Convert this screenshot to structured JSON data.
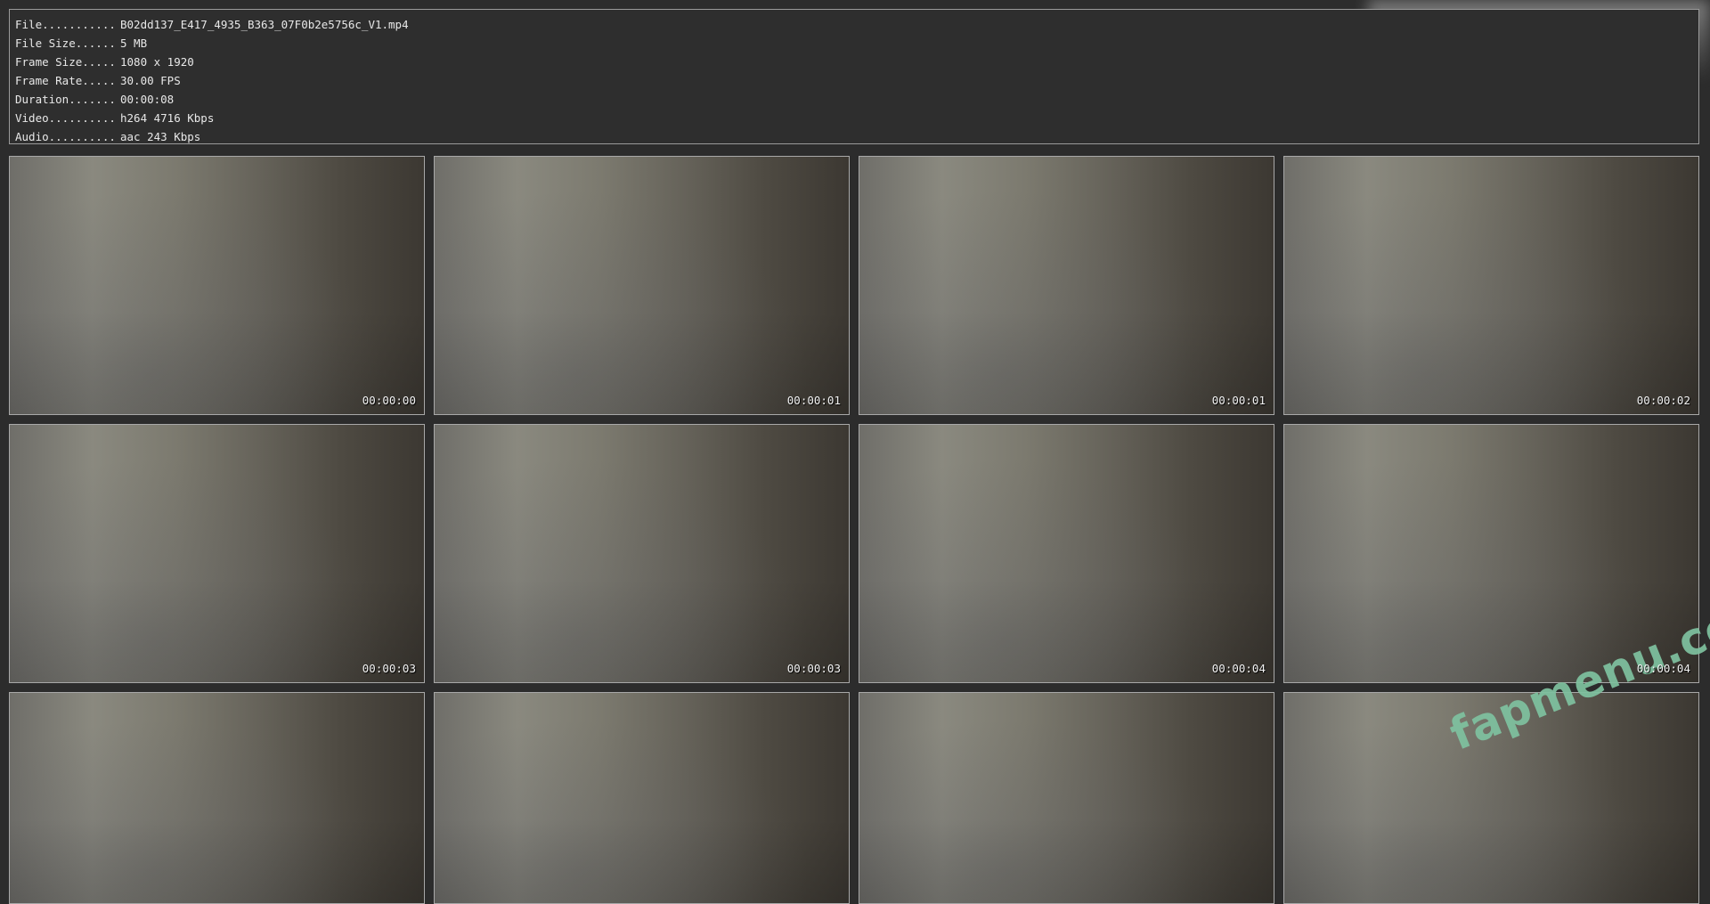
{
  "info": [
    {
      "key": "File...........",
      "value": "B02dd137_E417_4935_B363_07F0b2e5756c_V1.mp4"
    },
    {
      "key": "File Size......",
      "value": "5 MB"
    },
    {
      "key": "Frame Size.....",
      "value": "1080 x 1920"
    },
    {
      "key": "Frame Rate.....",
      "value": "30.00 FPS"
    },
    {
      "key": "Duration.......",
      "value": "00:00:08"
    },
    {
      "key": "Video..........",
      "value": "h264 4716 Kbps"
    },
    {
      "key": "Audio..........",
      "value": "aac 243 Kbps"
    }
  ],
  "thumbnails": [
    {
      "timestamp": "00:00:00"
    },
    {
      "timestamp": "00:00:01"
    },
    {
      "timestamp": "00:00:01"
    },
    {
      "timestamp": "00:00:02"
    },
    {
      "timestamp": "00:00:03"
    },
    {
      "timestamp": "00:00:03"
    },
    {
      "timestamp": "00:00:04"
    },
    {
      "timestamp": "00:00:04"
    },
    {
      "timestamp": ""
    },
    {
      "timestamp": ""
    },
    {
      "timestamp": ""
    },
    {
      "timestamp": ""
    }
  ],
  "watermark": "fapmenu.com"
}
